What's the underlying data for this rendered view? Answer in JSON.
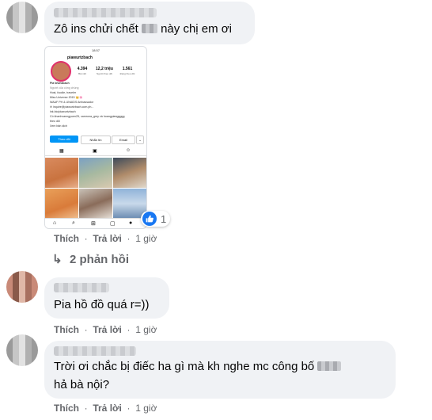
{
  "comments": [
    {
      "text": "Zô ins chửi chết ",
      "text_after": " này chị em ơi",
      "actions": {
        "like": "Thích",
        "reply": "Trả lời",
        "time": "1 giờ"
      },
      "reaction_count": "1",
      "replies_label": "2 phản hồi"
    },
    {
      "text": "Pia hồ đồ quá r=))",
      "actions": {
        "like": "Thích",
        "reply": "Trả lời",
        "time": "1 giờ"
      }
    },
    {
      "text_line1": "Trời ơi chắc bị điếc ha gì mà kh nghe mc công bố ",
      "text_line2": "hả bà nội?",
      "actions": {
        "like": "Thích",
        "reply": "Trả lời",
        "time": "1 giờ"
      }
    }
  ],
  "instagram": {
    "status_time": "18:57",
    "handle": "piawurtzbach",
    "posts": "4.394",
    "posts_label": "Bài viết",
    "followers": "12,2 triệu",
    "followers_label": "Người theo dõi",
    "following": "1.561",
    "following_label": "Đang theo dõi",
    "bio": [
      "Pia Wurtzbach",
      "Người của công chúng",
      "Host, foodie, traveler",
      "Miss Universe 2015 👑🌸",
      "WAAF PH & UNAIDS Ambassador",
      "✉ inquire@piawurtzbach.com.ph...",
      "lnk.bio/piawurtzbach",
      "Có khanhvanngyuen25, camrona_grey và hoangpianggggg",
      "theo dõi",
      "Xem bản dịch"
    ],
    "follow_btn": "Theo dõi",
    "message_btn": "Nhắn tin",
    "email_btn": "Email"
  },
  "icons": {
    "reply_arrow": "reply-arrow-icon",
    "like": "like-thumb-icon"
  },
  "colors": {
    "bubble": "#f0f2f5",
    "meta": "#65676b",
    "like_blue": "#1877f2",
    "ig_follow": "#0095f6"
  }
}
